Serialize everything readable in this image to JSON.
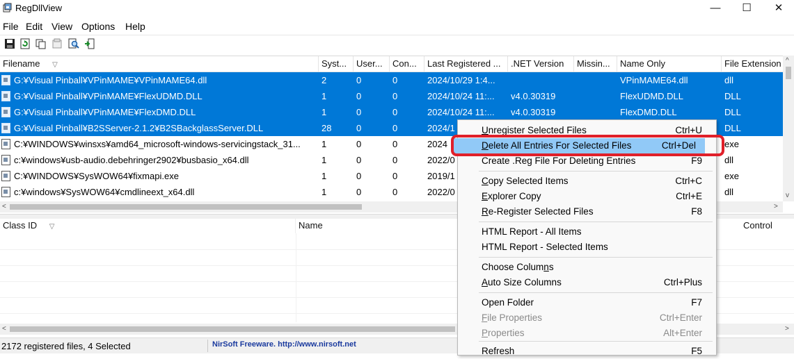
{
  "window": {
    "title": "RegDllView",
    "minimize_glyph": "—",
    "maximize_glyph": "☐",
    "close_glyph": "✕"
  },
  "menubar": [
    "File",
    "Edit",
    "View",
    "Options",
    "Help"
  ],
  "toolbar": {
    "icons": [
      "save-icon",
      "refresh-icon",
      "copy-icon",
      "properties-icon",
      "find-icon",
      "exit-icon"
    ]
  },
  "upper_grid": {
    "columns": [
      "Filename",
      "Syst...",
      "User...",
      "Con...",
      "Last Registered ...",
      ".NET Version",
      "Missin...",
      "Name Only",
      "File Extension"
    ],
    "sort_indicator": "▽",
    "rows": [
      {
        "selected": true,
        "cells": [
          "G:¥Visual Pinball¥VPinMAME¥VPinMAME64.dll",
          "2",
          "0",
          "0",
          "2024/10/29 1:4...",
          "",
          "",
          "VPinMAME64.dll",
          "dll"
        ]
      },
      {
        "selected": true,
        "cells": [
          "G:¥Visual Pinball¥VPinMAME¥FlexUDMD.DLL",
          "1",
          "0",
          "0",
          "2024/10/24 11:...",
          "v4.0.30319",
          "",
          "FlexUDMD.DLL",
          "DLL"
        ]
      },
      {
        "selected": true,
        "cells": [
          "G:¥Visual Pinball¥VPinMAME¥FlexDMD.DLL",
          "1",
          "0",
          "0",
          "2024/10/24 11:...",
          "v4.0.30319",
          "",
          "FlexDMD.DLL",
          "DLL"
        ]
      },
      {
        "selected": true,
        "cells": [
          "G:¥Visual Pinball¥B2SServer-2.1.2¥B2SBackglassServer.DLL",
          "28",
          "0",
          "0",
          "2024/1",
          "",
          "",
          "",
          "DLL"
        ]
      },
      {
        "selected": false,
        "cells": [
          "C:¥WINDOWS¥winsxs¥amd64_microsoft-windows-servicingstack_31...",
          "1",
          "0",
          "0",
          "2024",
          "",
          "",
          "",
          "exe"
        ]
      },
      {
        "selected": false,
        "cells": [
          "c:¥windows¥usb-audio.debehringer2902¥busbasio_x64.dll",
          "1",
          "0",
          "0",
          "2022/0",
          "",
          "",
          "",
          "dll"
        ]
      },
      {
        "selected": false,
        "cells": [
          "C:¥WINDOWS¥SysWOW64¥fixmapi.exe",
          "1",
          "0",
          "0",
          "2019/1",
          "",
          "",
          "",
          "exe"
        ]
      },
      {
        "selected": false,
        "cells": [
          "c:¥windows¥SysWOW64¥cmdlineext_x64.dll",
          "1",
          "0",
          "0",
          "2022/0",
          "",
          "",
          "",
          "dll"
        ]
      }
    ]
  },
  "lower_grid": {
    "columns": [
      "Class ID",
      "Name",
      "Control"
    ]
  },
  "scroll": {
    "left": "<",
    "right": ">",
    "up": "^",
    "down": "v"
  },
  "status": {
    "count": "2172 registered files, 4 Selected",
    "brand": "NirSoft Freeware.  http://www.nirsoft.net"
  },
  "context_menu": {
    "items": [
      {
        "pre": "",
        "u": "U",
        "post": "nregister Selected Files",
        "key": "Ctrl+U",
        "disabled": false,
        "highlighted": false
      },
      {
        "pre": "",
        "u": "D",
        "post": "elete All Entries For Selected Files",
        "key": "Ctrl+Del",
        "disabled": false,
        "highlighted": true
      },
      {
        "pre": "Create .Reg File For Deleting Entries",
        "u": "",
        "post": "",
        "key": "F9",
        "disabled": false,
        "highlighted": false
      },
      {
        "pre": "",
        "u": "C",
        "post": "opy Selected Items",
        "key": "Ctrl+C",
        "disabled": false,
        "highlighted": false
      },
      {
        "pre": "",
        "u": "E",
        "post": "xplorer Copy",
        "key": "Ctrl+E",
        "disabled": false,
        "highlighted": false
      },
      {
        "pre": "",
        "u": "R",
        "post": "e-Register Selected Files",
        "key": "F8",
        "disabled": false,
        "highlighted": false
      },
      {
        "pre": "HTML Report - All Items",
        "u": "",
        "post": "",
        "key": "",
        "disabled": false,
        "highlighted": false
      },
      {
        "pre": "HTML Report - Selected Items",
        "u": "",
        "post": "",
        "key": "",
        "disabled": false,
        "highlighted": false
      },
      {
        "pre": "Choose Colum",
        "u": "n",
        "post": "s",
        "key": "",
        "disabled": false,
        "highlighted": false
      },
      {
        "pre": "",
        "u": "A",
        "post": "uto Size Columns",
        "key": "Ctrl+Plus",
        "disabled": false,
        "highlighted": false
      },
      {
        "pre": "Open Folder",
        "u": "",
        "post": "",
        "key": "F7",
        "disabled": false,
        "highlighted": false
      },
      {
        "pre": "",
        "u": "F",
        "post": "ile Properties",
        "key": "Ctrl+Enter",
        "disabled": true,
        "highlighted": false
      },
      {
        "pre": "",
        "u": "P",
        "post": "roperties",
        "key": "Alt+Enter",
        "disabled": true,
        "highlighted": false
      },
      {
        "pre": "Refresh",
        "u": "",
        "post": "",
        "key": "F5",
        "disabled": false,
        "highlighted": false
      }
    ]
  },
  "colors": {
    "selection": "#0078d7",
    "menu_highlight": "#91c9f7",
    "annotation_red": "#e0202a",
    "brand_blue": "#1a3a9e"
  }
}
